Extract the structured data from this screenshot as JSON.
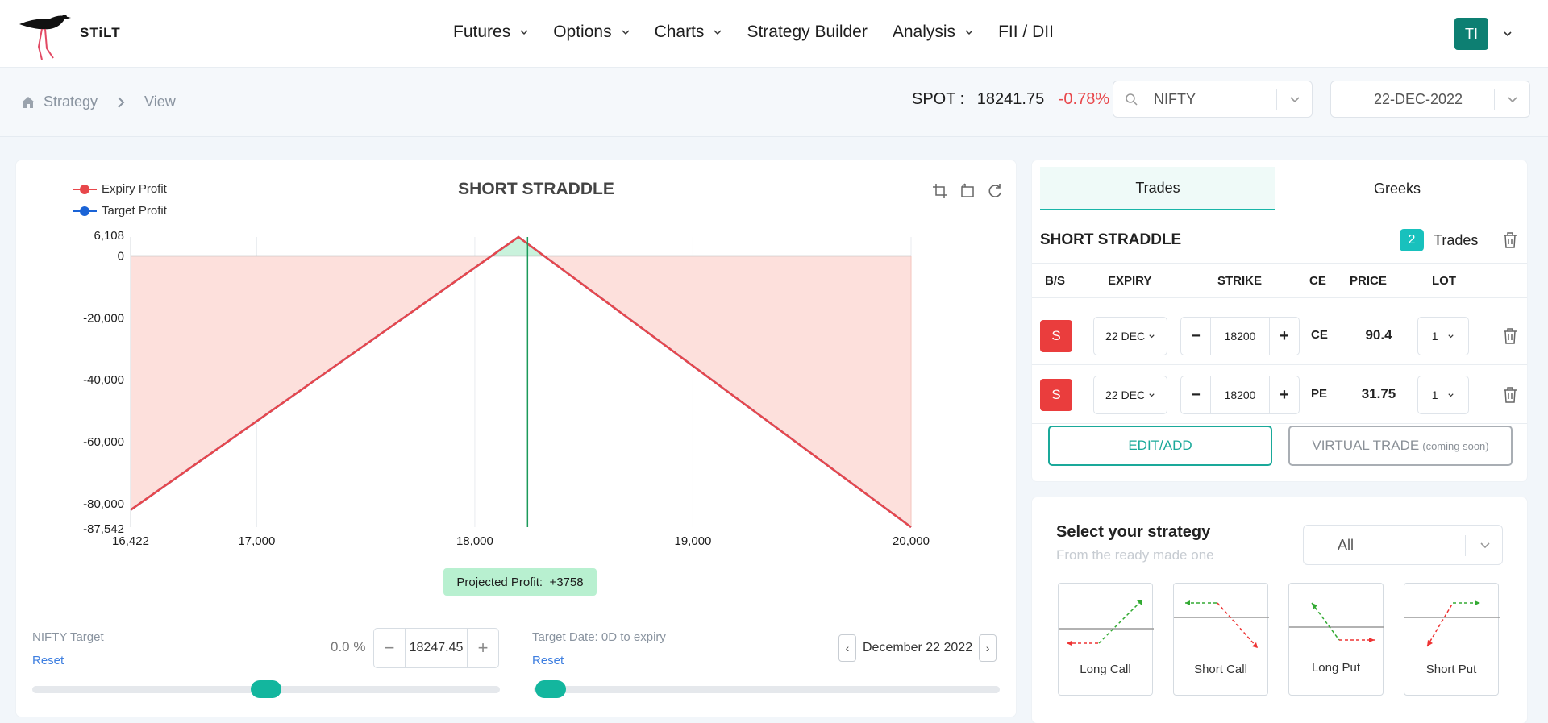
{
  "brand": "STiLT",
  "nav": [
    {
      "label": "Futures",
      "dropdown": true
    },
    {
      "label": "Options",
      "dropdown": true
    },
    {
      "label": "Charts",
      "dropdown": true
    },
    {
      "label": "Strategy Builder",
      "dropdown": false
    },
    {
      "label": "Analysis",
      "dropdown": true
    },
    {
      "label": "FII / DII",
      "dropdown": false
    }
  ],
  "user": {
    "initials": "TI"
  },
  "breadcrumb": {
    "items": [
      "Strategy",
      "View"
    ]
  },
  "spot": {
    "label": "SPOT :",
    "value": "18241.75",
    "change": "-0.78%"
  },
  "symbol_select": {
    "value": "NIFTY"
  },
  "expiry_select": {
    "value": "22-DEC-2022"
  },
  "chart": {
    "title": "SHORT STRADDLE",
    "legend": [
      {
        "name": "Expiry Profit",
        "color": "#e8474b"
      },
      {
        "name": "Target Profit",
        "color": "#1a63d6"
      }
    ],
    "projected_label": "Projected Profit:",
    "projected_value": "+3758"
  },
  "chart_data": {
    "type": "line",
    "title": "SHORT STRADDLE",
    "x_ticks": [
      "16,422",
      "17,000",
      "18,000",
      "19,000",
      "20,000"
    ],
    "y_ticks": [
      "6,108",
      "0",
      "-20,000",
      "-40,000",
      "-60,000",
      "-80,000",
      "-87,542"
    ],
    "xlim": [
      16422,
      20000
    ],
    "ylim": [
      -87542,
      6108
    ],
    "spot_marker": 18241.75,
    "series": [
      {
        "name": "Expiry Profit",
        "color": "#e8474b",
        "x": [
          16422,
          18200,
          20000
        ],
        "y": [
          -82000,
          6108,
          -87542
        ]
      },
      {
        "name": "Target Profit",
        "color": "#1a63d6",
        "x": [
          16422,
          18200,
          20000
        ],
        "y": [
          -82000,
          6108,
          -87542
        ]
      }
    ],
    "grid": true,
    "legend": "top-left"
  },
  "target": {
    "label": "NIFTY Target",
    "reset": "Reset",
    "percent": "0.0 %",
    "value": "18247.45",
    "slider": 0.5
  },
  "target_date": {
    "label": "Target Date: 0D to expiry",
    "reset": "Reset",
    "value": "December 22 2022",
    "slider": 0.0
  },
  "trades": {
    "tabs": [
      "Trades",
      "Greeks"
    ],
    "strategy_name": "SHORT STRADDLE",
    "count": "2",
    "count_label": "Trades",
    "columns": [
      "B/S",
      "EXPIRY",
      "STRIKE",
      "CE",
      "PRICE",
      "LOT"
    ],
    "rows": [
      {
        "bs": "S",
        "expiry": "22 DEC",
        "strike": "18200",
        "type": "CE",
        "price": "90.4",
        "lot": "1"
      },
      {
        "bs": "S",
        "expiry": "22 DEC",
        "strike": "18200",
        "type": "PE",
        "price": "31.75",
        "lot": "1"
      }
    ],
    "edit_label": "EDIT/ADD",
    "virtual_label": "VIRTUAL TRADE",
    "virtual_note": "(coming soon)"
  },
  "strategy": {
    "title": "Select your strategy",
    "subtitle": "From the ready made one",
    "filter": "All",
    "cards": [
      "Long Call",
      "Short Call",
      "Long Put",
      "Short Put"
    ]
  },
  "colors": {
    "accent": "#13b69e",
    "loss": "#fde0dc",
    "profit": "#c9f2dc",
    "sell": "#ea3d3d"
  }
}
